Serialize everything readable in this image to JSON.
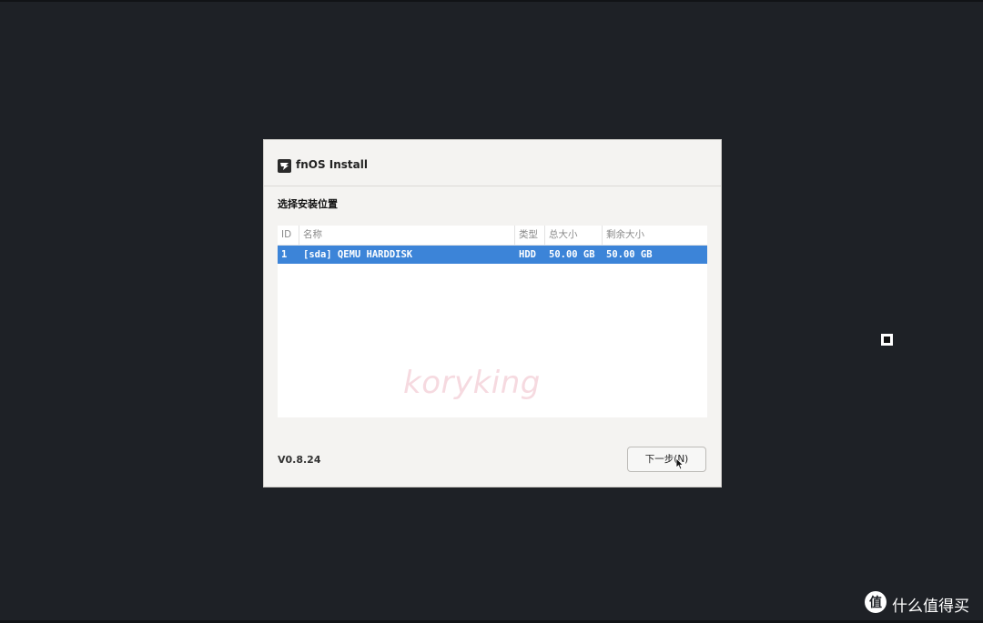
{
  "window": {
    "title": "fnOS Install",
    "icon": "fnos-logo-icon"
  },
  "section_title": "选择安装位置",
  "disk_table": {
    "columns": [
      "ID",
      "名称",
      "类型",
      "总大小",
      "剩余大小"
    ],
    "rows": [
      {
        "id": "1",
        "name": "[sda] QEMU HARDDISK",
        "type": "HDD",
        "total": "50.00 GB",
        "free": "50.00 GB",
        "selected": true
      }
    ]
  },
  "watermark": "koryking",
  "version": "V0.8.24",
  "buttons": {
    "next": "下一步(N)"
  },
  "brand": {
    "text": "什么值得买",
    "icon": "smzdm-logo-icon"
  },
  "colors": {
    "background": "#1e2126",
    "dialog": "#f4f3f1",
    "selection": "#3c84d8"
  }
}
